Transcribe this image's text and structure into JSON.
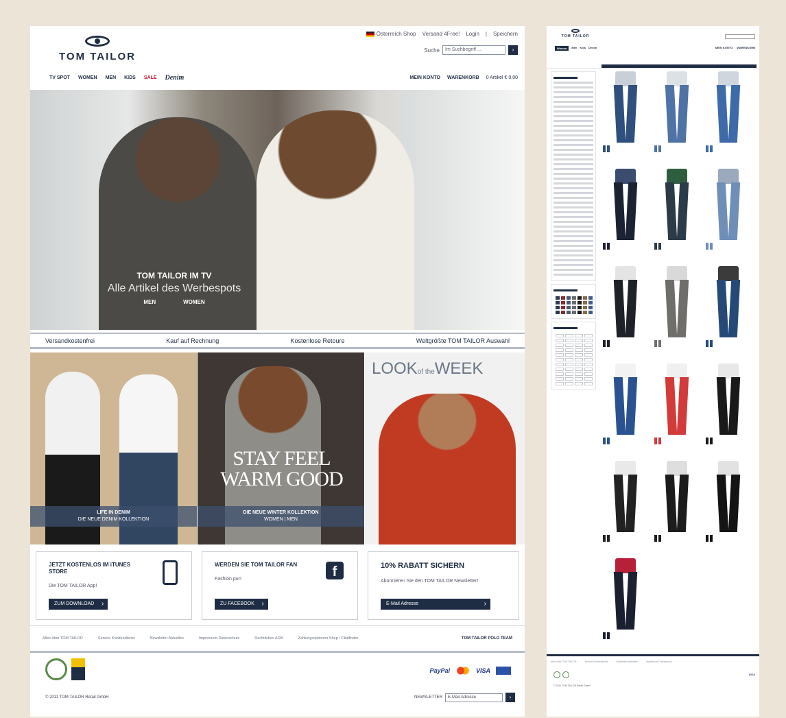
{
  "home": {
    "header": {
      "brand": "TOM TAILOR",
      "country": "Österreich Shop",
      "service": "Versand 4Free!",
      "login": "Login",
      "register": "Speichern",
      "search_label": "Suche",
      "search_placeholder": "Im Suchbegriff ...",
      "nav": [
        "TV SPOT",
        "WOMEN",
        "MEN",
        "KIDS",
        "SALE"
      ],
      "denim": "Denim",
      "account": "MEIN KONTO",
      "basket": "WARENKORB",
      "cart_summary": "0 Artikel  € 0,00"
    },
    "hero": {
      "title": "TOM TAILOR IM TV",
      "subtitle": "Alle Artikel des Werbespots",
      "link_men": "MEN",
      "link_women": "WOMEN"
    },
    "usp": [
      "Versandkostenfrei",
      "Kauf auf Rechnung",
      "Kostenlose Retoure",
      "Weltgrößte TOM TAILOR Auswahl"
    ],
    "teasers": [
      {
        "line1": "LIFE IN DENIM",
        "line2": "DIE NEUE DENIM KOLLEKTION"
      },
      {
        "headline": "STAY FEEL WARM GOOD",
        "line1": "DIE NEUE WINTER KOLLEKTION",
        "line2": "WOMEN  |  MEN"
      },
      {
        "headline_big1": "LOOK",
        "headline_small": "of the",
        "headline_big2": "WEEK"
      }
    ],
    "promos": [
      {
        "title": "JETZT KOSTENLOS IM iTUNES STORE",
        "text": "Die TOM TAILOR App!",
        "button": "ZUM DOWNLOAD"
      },
      {
        "title": "WERDEN SIE TOM TAILOR FAN",
        "text": "Fashion pur!",
        "button": "ZU FACEBOOK"
      },
      {
        "title": "10% RABATT SICHERN",
        "text": "Abonnieren Sie den TOM TAILOR Newsletter!",
        "button": "E-Mail Adresse"
      }
    ],
    "footer_links": [
      "Alles über TOM TAILOR",
      "Service Kundendienst",
      "Newsletter Aktuelles",
      "Impressum Datenschutz",
      "Rechtliches AGB",
      "Zahlungsoptionen Shop / Filialfinder"
    ],
    "polo_team": "TOM TAILOR POLO TEAM",
    "payment": [
      "PayPal",
      "VISA"
    ],
    "copyright": "© 2011 TOM TAILOR Retail GmbH",
    "newsletter_label": "NEWSLETTER",
    "newsletter_placeholder": "E-Mail-Adresse"
  },
  "listing": {
    "brand": "TOM TAILOR",
    "tabs": [
      "Women",
      "Men",
      "Kids",
      "Denim"
    ],
    "account": "MEIN KONTO",
    "basket": "WARENKORB",
    "copyright": "© 2011 TOM TAILOR Retail GmbH",
    "swatch_colors": [
      "#2c3a55",
      "#8a2b30",
      "#4a5a72",
      "#6b6b6b",
      "#1c1c1c",
      "#8b6a4a",
      "#3f5f8a"
    ]
  }
}
